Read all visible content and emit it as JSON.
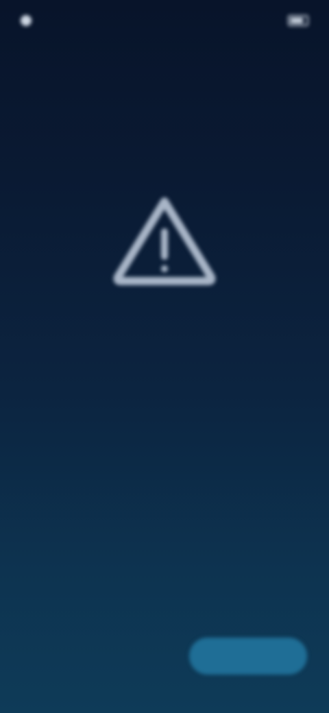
{
  "status_bar": {
    "time": "",
    "battery_icon": "battery-icon"
  },
  "alert": {
    "icon": "warning-triangle-icon",
    "title": "",
    "subtitle": "",
    "message": "",
    "details": ""
  },
  "actions": {
    "secondary_label": "",
    "primary_label": ""
  },
  "colors": {
    "background_top": "#08142a",
    "background_bottom": "#0e3b58",
    "primary_button": "#1f6e96",
    "icon_stroke": "#a9b6c8"
  }
}
